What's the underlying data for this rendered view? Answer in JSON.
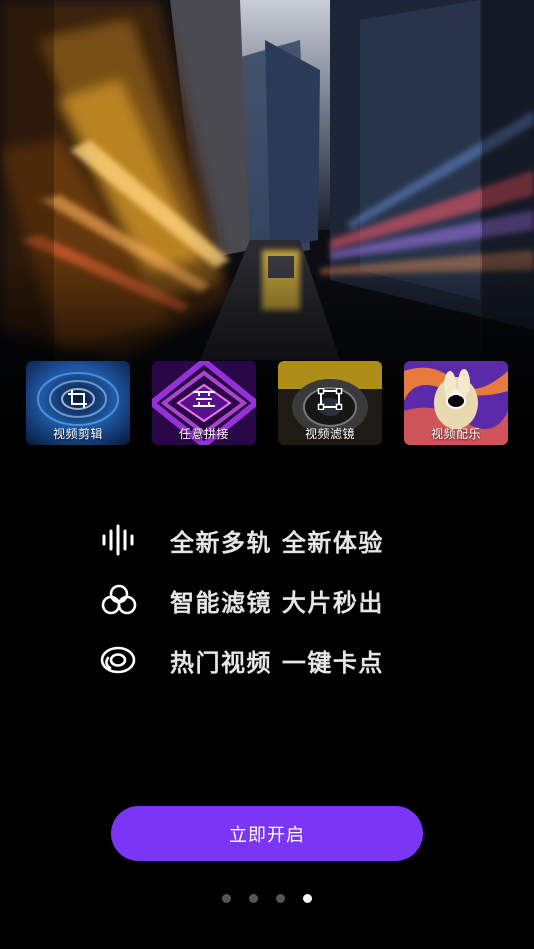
{
  "cards": [
    {
      "label": "视频剪辑",
      "icon": "crop-icon"
    },
    {
      "label": "任意拼接",
      "icon": "splice-icon"
    },
    {
      "label": "视频滤镜",
      "icon": "filter-frame-icon"
    },
    {
      "label": "视频配乐",
      "icon": "music-icon"
    }
  ],
  "features": [
    {
      "text": "全新多轨 全新体验",
      "icon": "waveform-icon"
    },
    {
      "text": "智能滤镜 大片秒出",
      "icon": "overlap-circles-icon"
    },
    {
      "text": "热门视频 一键卡点",
      "icon": "play-circle-icon"
    }
  ],
  "cta": {
    "label": "立即开启",
    "color": "#7a35f5"
  },
  "pagination": {
    "total": 4,
    "current": 4
  },
  "colors": {
    "background": "#000000",
    "accent": "#7a35f5",
    "dot_inactive": "#555555",
    "dot_active": "#ffffff"
  }
}
